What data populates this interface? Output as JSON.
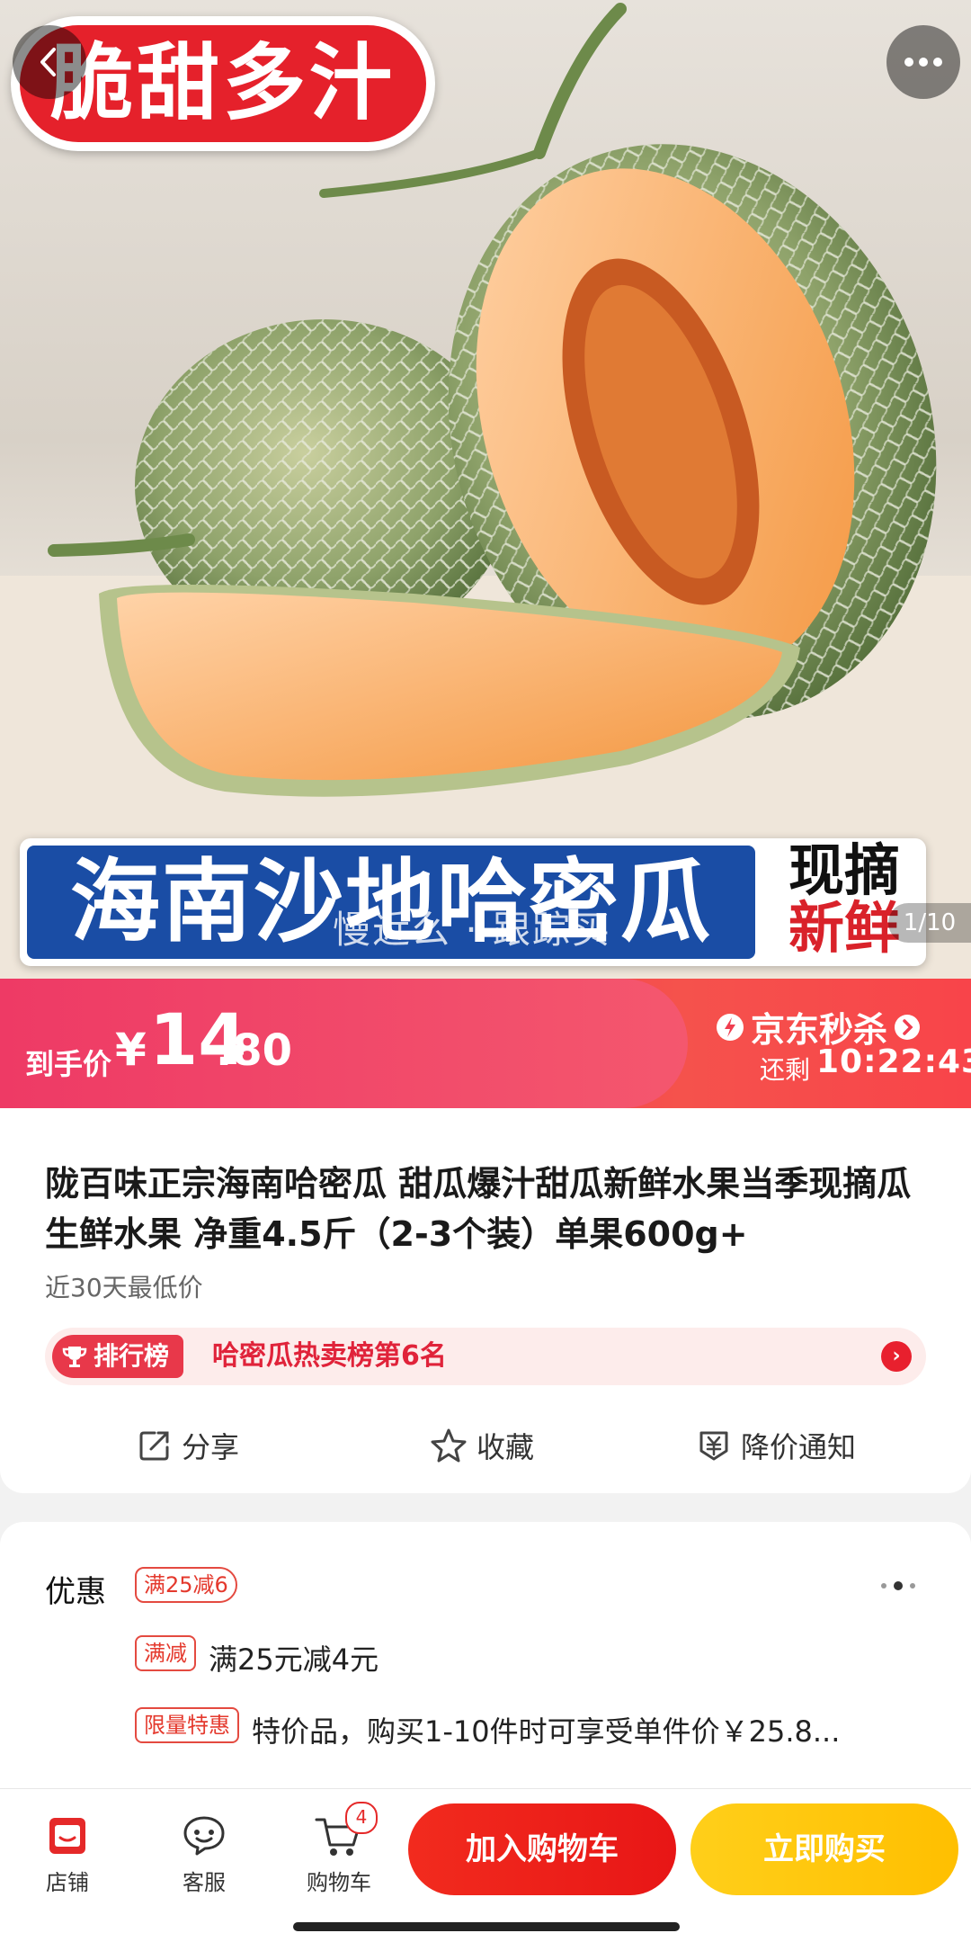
{
  "hero": {
    "badge_text": "脆甜多汁",
    "banner_title": "海南沙地哈密瓜",
    "banner_right_line1": "现摘",
    "banner_right_line2": "新鲜",
    "overlay_text": "慢近么 · 跟踪买",
    "image_counter": "1/10"
  },
  "price_bar": {
    "label": "到手价",
    "currency": "¥",
    "integer": "14",
    "decimal": ".80",
    "seckill_title": "京东秒杀",
    "remain_label": "还剩",
    "countdown": "10:22:43"
  },
  "product": {
    "title": "陇百味正宗海南哈密瓜 甜瓜爆汁甜瓜新鲜水果当季现摘瓜生鲜水果 净重4.5斤（2-3个装）单果600g+",
    "subtitle": "近30天最低价",
    "rank_tag": "排行榜",
    "rank_text": "哈密瓜热卖榜第6名",
    "rank_arrow": "›"
  },
  "actions": {
    "share": "分享",
    "favorite": "收藏",
    "price_alert": "降价通知"
  },
  "promo": {
    "label": "优惠",
    "top_tag": "满25减6",
    "row1_tag": "满减",
    "row1_text": "满25元减4元",
    "row2_tag": "限量特惠",
    "row2_text": "特价品，购买1-10件时可享受单件价￥25.8..."
  },
  "bottom_bar": {
    "store": "店铺",
    "service": "客服",
    "cart": "购物车",
    "cart_count": "4",
    "add_to_cart": "加入购物车",
    "buy_now": "立即购买"
  },
  "colors": {
    "accent_red": "#e52929",
    "price_pink": "#f0406a",
    "buy_yellow": "#ffc20e",
    "banner_blue": "#1a4da5"
  }
}
